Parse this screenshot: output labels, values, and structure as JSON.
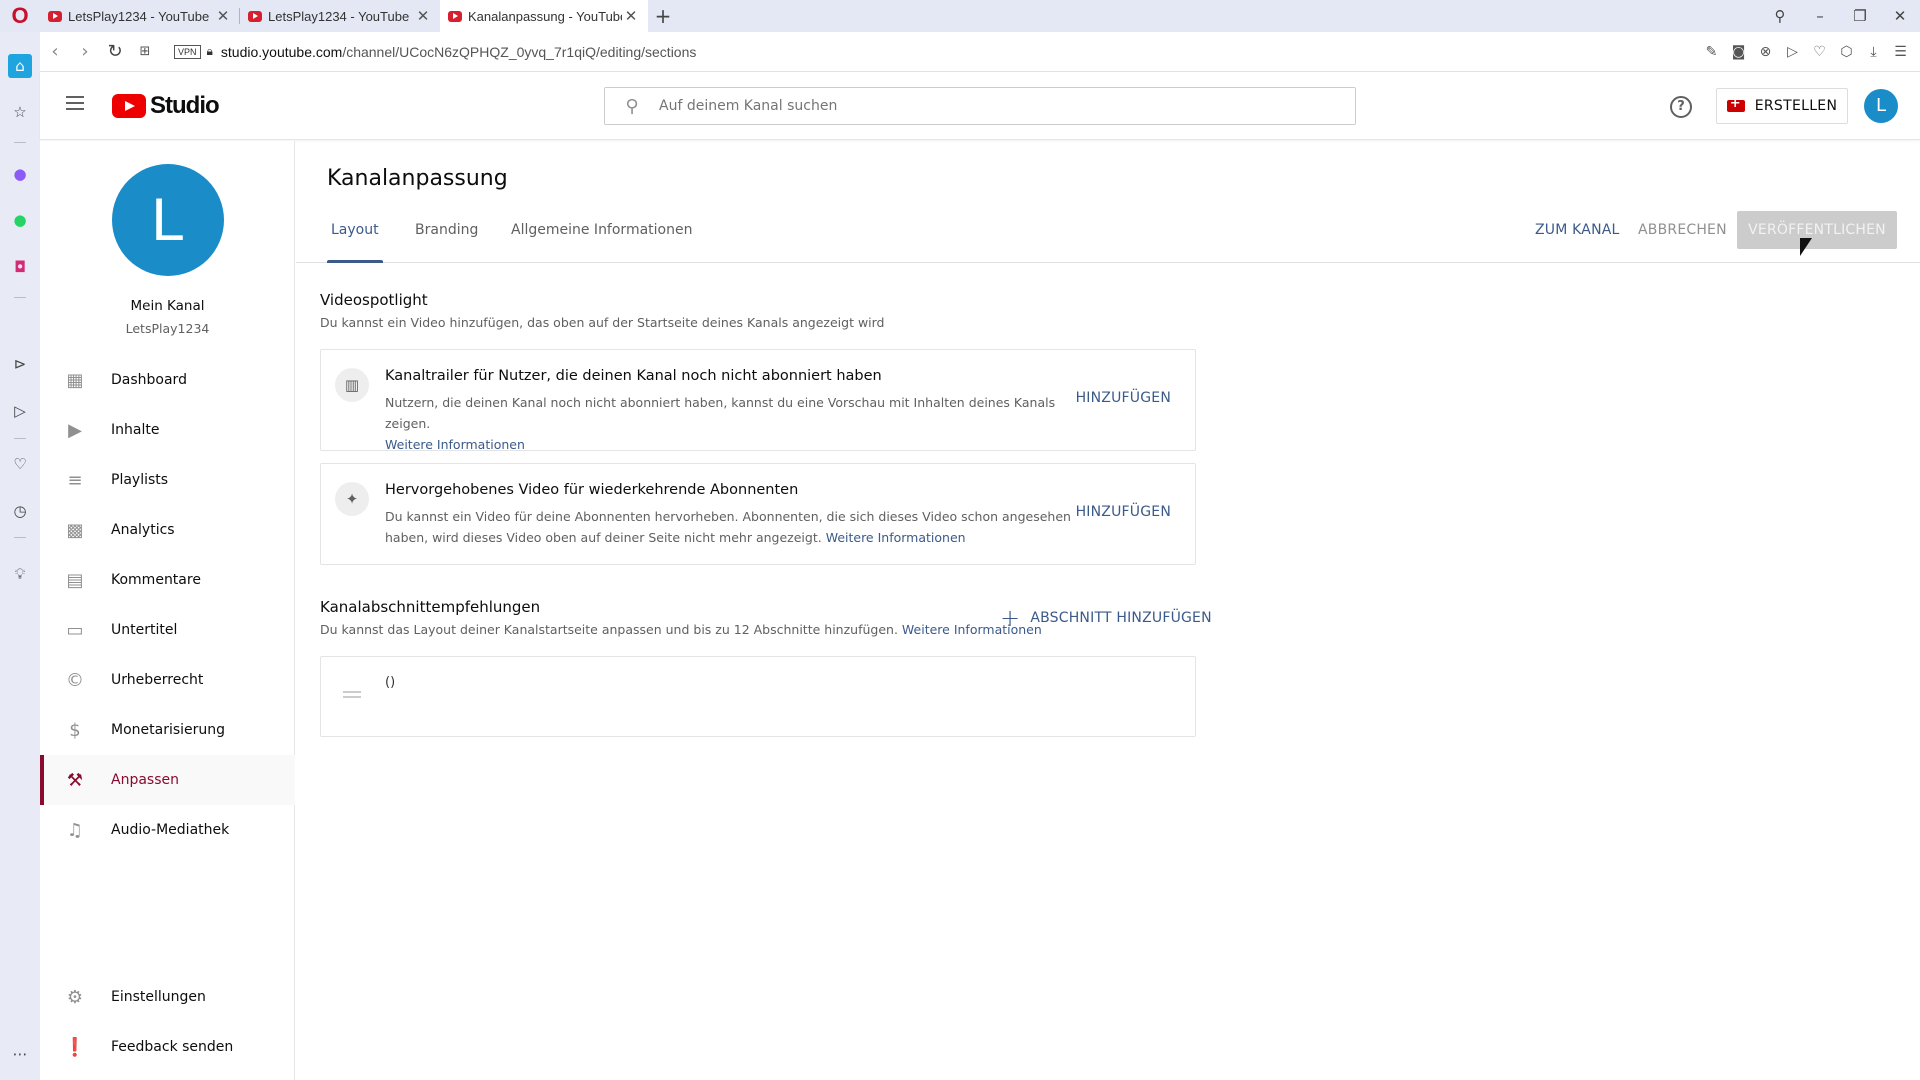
{
  "browser": {
    "tabs": [
      {
        "title": "LetsPlay1234 - YouTube",
        "active": false
      },
      {
        "title": "LetsPlay1234 - YouTube",
        "active": false
      },
      {
        "title": "Kanalanpassung - YouTube",
        "active": true
      }
    ],
    "new_tab": "+",
    "url_host": "studio.youtube.com",
    "url_path": "/channel/UCocN6zQPHQZ_0yvq_7r1qiQ/editing/sections",
    "vpn_label": "VPN"
  },
  "header": {
    "logo_text": "Studio",
    "search_placeholder": "Auf deinem Kanal suchen",
    "create_label": "ERSTELLEN",
    "avatar_letter": "L"
  },
  "sidebar": {
    "avatar_letter": "L",
    "channel_name": "Mein Kanal",
    "channel_handle": "LetsPlay1234",
    "items": [
      {
        "label": "Dashboard",
        "icon": "dashboard-icon"
      },
      {
        "label": "Inhalte",
        "icon": "content-icon"
      },
      {
        "label": "Playlists",
        "icon": "playlists-icon"
      },
      {
        "label": "Analytics",
        "icon": "analytics-icon"
      },
      {
        "label": "Kommentare",
        "icon": "comments-icon"
      },
      {
        "label": "Untertitel",
        "icon": "subtitles-icon"
      },
      {
        "label": "Urheberrecht",
        "icon": "copyright-icon"
      },
      {
        "label": "Monetarisierung",
        "icon": "dollar-icon"
      },
      {
        "label": "Anpassen",
        "icon": "magic-wand-icon",
        "active": true
      },
      {
        "label": "Audio-Mediathek",
        "icon": "audio-library-icon"
      }
    ],
    "bottom_items": [
      {
        "label": "Einstellungen",
        "icon": "gear-icon"
      },
      {
        "label": "Feedback senden",
        "icon": "feedback-icon"
      }
    ]
  },
  "main": {
    "title": "Kanalanpassung",
    "tabs": [
      {
        "label": "Layout",
        "active": true
      },
      {
        "label": "Branding"
      },
      {
        "label": "Allgemeine Informationen"
      }
    ],
    "actions": {
      "to_channel": "ZUM KANAL",
      "cancel": "ABBRECHEN",
      "publish": "VERÖFFENTLICHEN"
    },
    "spotlight": {
      "title": "Videospotlight",
      "desc": "Du kannst ein Video hinzufügen, das oben auf der Startseite deines Kanals angezeigt wird",
      "cards": [
        {
          "title": "Kanaltrailer für Nutzer, die deinen Kanal noch nicht abonniert haben",
          "desc": "Nutzern, die deinen Kanal noch nicht abonniert haben, kannst du eine Vorschau mit Inhalten deines Kanals zeigen.",
          "link": "Weitere Informationen",
          "button": "HINZUFÜGEN"
        },
        {
          "title": "Hervorgehobenes Video für wiederkehrende Abonnenten",
          "desc": "Du kannst ein Video für deine Abonnenten hervorheben. Abonnenten, die sich dieses Video schon angesehen haben, wird dieses Video oben auf deiner Seite nicht mehr angezeigt.",
          "link": "Weitere Informationen",
          "button": "HINZUFÜGEN"
        }
      ]
    },
    "sections": {
      "title": "Kanalabschnittempfehlungen",
      "desc": "Du kannst das Layout deiner Kanalstartseite anpassen und bis zu 12 Abschnitte hinzufügen.",
      "link": "Weitere Informationen",
      "add_button": "ABSCHNITT HINZUFÜGEN",
      "item_label": "()"
    }
  }
}
